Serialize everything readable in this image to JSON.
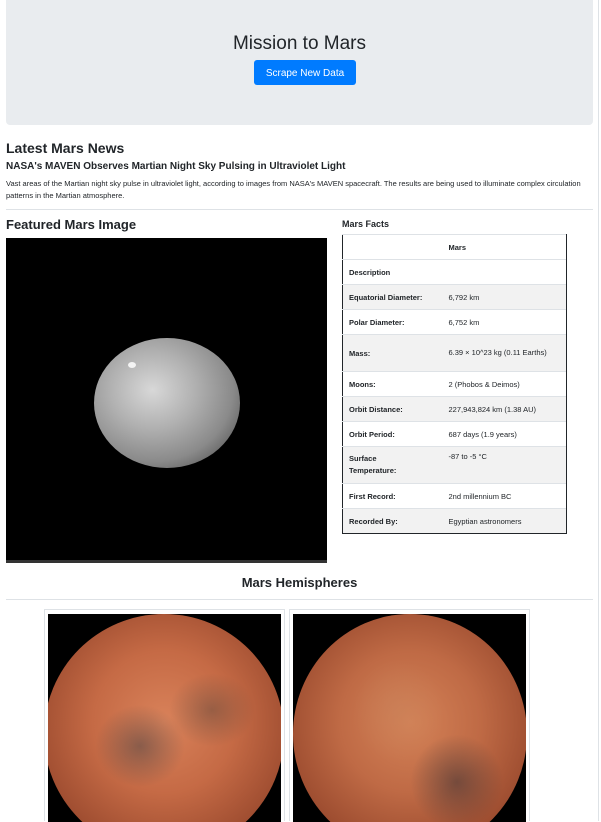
{
  "header": {
    "title": "Mission to Mars",
    "scrape_button_label": "Scrape New Data"
  },
  "news": {
    "section_title": "Latest Mars News",
    "headline": "NASA's MAVEN Observes Martian Night Sky Pulsing in Ultraviolet Light",
    "body": "Vast areas of the Martian night sky pulse in ultraviolet light, according to images from NASA's MAVEN spacecraft. The results are being used to illuminate complex circulation patterns in the Martian atmosphere."
  },
  "featured": {
    "section_title": "Featured Mars Image"
  },
  "facts": {
    "section_title": "Mars Facts",
    "column_header": "Mars",
    "rows": [
      {
        "label": "Description",
        "value": ""
      },
      {
        "label": "Equatorial Diameter:",
        "value": "6,792 km"
      },
      {
        "label": "Polar Diameter:",
        "value": "6,752 km"
      },
      {
        "label": "Mass:",
        "value": "6.39 × 10^23 kg (0.11 Earths)"
      },
      {
        "label": "Moons:",
        "value": "2 (Phobos & Deimos)"
      },
      {
        "label": "Orbit Distance:",
        "value": "227,943,824 km (1.38 AU)"
      },
      {
        "label": "Orbit Period:",
        "value": "687 days (1.9 years)"
      },
      {
        "label": "Surface Temperature:",
        "value": "-87 to -5 °C"
      },
      {
        "label": "First Record:",
        "value": "2nd millennium BC"
      },
      {
        "label": "Recorded By:",
        "value": "Egyptian astronomers"
      }
    ]
  },
  "hemispheres": {
    "section_title": "Mars Hemispheres"
  },
  "colors": {
    "accent": "#007bff",
    "jumbotron_bg": "#e9ecef"
  }
}
